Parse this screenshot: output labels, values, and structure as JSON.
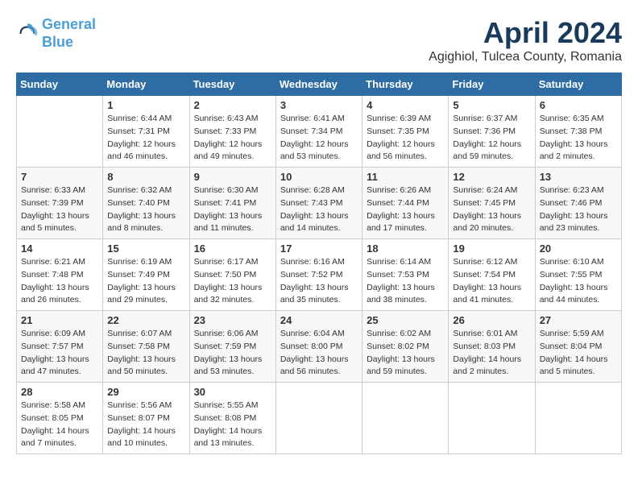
{
  "logo": {
    "line1": "General",
    "line2": "Blue"
  },
  "title": "April 2024",
  "subtitle": "Agighiol, Tulcea County, Romania",
  "days_header": [
    "Sunday",
    "Monday",
    "Tuesday",
    "Wednesday",
    "Thursday",
    "Friday",
    "Saturday"
  ],
  "weeks": [
    [
      {
        "day": "",
        "info": ""
      },
      {
        "day": "1",
        "info": "Sunrise: 6:44 AM\nSunset: 7:31 PM\nDaylight: 12 hours\nand 46 minutes."
      },
      {
        "day": "2",
        "info": "Sunrise: 6:43 AM\nSunset: 7:33 PM\nDaylight: 12 hours\nand 49 minutes."
      },
      {
        "day": "3",
        "info": "Sunrise: 6:41 AM\nSunset: 7:34 PM\nDaylight: 12 hours\nand 53 minutes."
      },
      {
        "day": "4",
        "info": "Sunrise: 6:39 AM\nSunset: 7:35 PM\nDaylight: 12 hours\nand 56 minutes."
      },
      {
        "day": "5",
        "info": "Sunrise: 6:37 AM\nSunset: 7:36 PM\nDaylight: 12 hours\nand 59 minutes."
      },
      {
        "day": "6",
        "info": "Sunrise: 6:35 AM\nSunset: 7:38 PM\nDaylight: 13 hours\nand 2 minutes."
      }
    ],
    [
      {
        "day": "7",
        "info": "Sunrise: 6:33 AM\nSunset: 7:39 PM\nDaylight: 13 hours\nand 5 minutes."
      },
      {
        "day": "8",
        "info": "Sunrise: 6:32 AM\nSunset: 7:40 PM\nDaylight: 13 hours\nand 8 minutes."
      },
      {
        "day": "9",
        "info": "Sunrise: 6:30 AM\nSunset: 7:41 PM\nDaylight: 13 hours\nand 11 minutes."
      },
      {
        "day": "10",
        "info": "Sunrise: 6:28 AM\nSunset: 7:43 PM\nDaylight: 13 hours\nand 14 minutes."
      },
      {
        "day": "11",
        "info": "Sunrise: 6:26 AM\nSunset: 7:44 PM\nDaylight: 13 hours\nand 17 minutes."
      },
      {
        "day": "12",
        "info": "Sunrise: 6:24 AM\nSunset: 7:45 PM\nDaylight: 13 hours\nand 20 minutes."
      },
      {
        "day": "13",
        "info": "Sunrise: 6:23 AM\nSunset: 7:46 PM\nDaylight: 13 hours\nand 23 minutes."
      }
    ],
    [
      {
        "day": "14",
        "info": "Sunrise: 6:21 AM\nSunset: 7:48 PM\nDaylight: 13 hours\nand 26 minutes."
      },
      {
        "day": "15",
        "info": "Sunrise: 6:19 AM\nSunset: 7:49 PM\nDaylight: 13 hours\nand 29 minutes."
      },
      {
        "day": "16",
        "info": "Sunrise: 6:17 AM\nSunset: 7:50 PM\nDaylight: 13 hours\nand 32 minutes."
      },
      {
        "day": "17",
        "info": "Sunrise: 6:16 AM\nSunset: 7:52 PM\nDaylight: 13 hours\nand 35 minutes."
      },
      {
        "day": "18",
        "info": "Sunrise: 6:14 AM\nSunset: 7:53 PM\nDaylight: 13 hours\nand 38 minutes."
      },
      {
        "day": "19",
        "info": "Sunrise: 6:12 AM\nSunset: 7:54 PM\nDaylight: 13 hours\nand 41 minutes."
      },
      {
        "day": "20",
        "info": "Sunrise: 6:10 AM\nSunset: 7:55 PM\nDaylight: 13 hours\nand 44 minutes."
      }
    ],
    [
      {
        "day": "21",
        "info": "Sunrise: 6:09 AM\nSunset: 7:57 PM\nDaylight: 13 hours\nand 47 minutes."
      },
      {
        "day": "22",
        "info": "Sunrise: 6:07 AM\nSunset: 7:58 PM\nDaylight: 13 hours\nand 50 minutes."
      },
      {
        "day": "23",
        "info": "Sunrise: 6:06 AM\nSunset: 7:59 PM\nDaylight: 13 hours\nand 53 minutes."
      },
      {
        "day": "24",
        "info": "Sunrise: 6:04 AM\nSunset: 8:00 PM\nDaylight: 13 hours\nand 56 minutes."
      },
      {
        "day": "25",
        "info": "Sunrise: 6:02 AM\nSunset: 8:02 PM\nDaylight: 13 hours\nand 59 minutes."
      },
      {
        "day": "26",
        "info": "Sunrise: 6:01 AM\nSunset: 8:03 PM\nDaylight: 14 hours\nand 2 minutes."
      },
      {
        "day": "27",
        "info": "Sunrise: 5:59 AM\nSunset: 8:04 PM\nDaylight: 14 hours\nand 5 minutes."
      }
    ],
    [
      {
        "day": "28",
        "info": "Sunrise: 5:58 AM\nSunset: 8:05 PM\nDaylight: 14 hours\nand 7 minutes."
      },
      {
        "day": "29",
        "info": "Sunrise: 5:56 AM\nSunset: 8:07 PM\nDaylight: 14 hours\nand 10 minutes."
      },
      {
        "day": "30",
        "info": "Sunrise: 5:55 AM\nSunset: 8:08 PM\nDaylight: 14 hours\nand 13 minutes."
      },
      {
        "day": "",
        "info": ""
      },
      {
        "day": "",
        "info": ""
      },
      {
        "day": "",
        "info": ""
      },
      {
        "day": "",
        "info": ""
      }
    ]
  ]
}
